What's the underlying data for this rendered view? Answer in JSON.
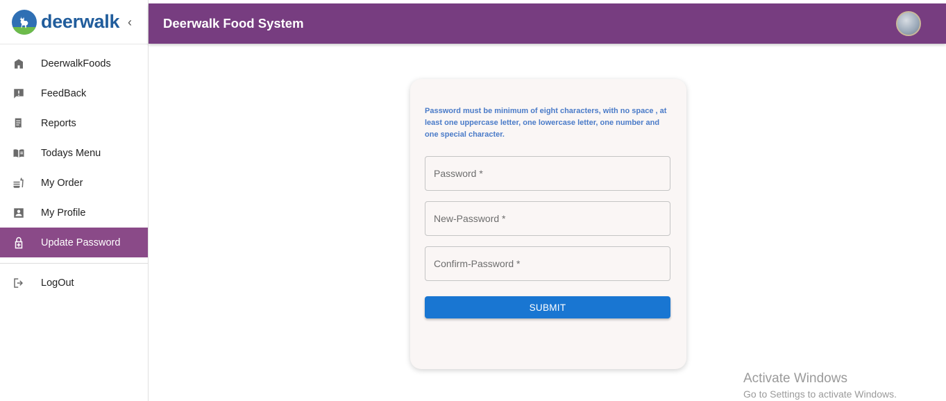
{
  "brand": {
    "name": "deerwalk",
    "logo_icon": "deer-logo-icon",
    "collapse_icon": "chevron-left-icon"
  },
  "sidebar": {
    "items": [
      {
        "label": "DeerwalkFoods",
        "icon": "home-icon"
      },
      {
        "label": "FeedBack",
        "icon": "feedback-icon"
      },
      {
        "label": "Reports",
        "icon": "receipt-icon"
      },
      {
        "label": "Todays Menu",
        "icon": "menu-book-icon"
      },
      {
        "label": "My Order",
        "icon": "order-icon"
      },
      {
        "label": "My Profile",
        "icon": "profile-icon"
      },
      {
        "label": "Update Password",
        "icon": "lock-plus-icon",
        "active": true
      }
    ],
    "logout": {
      "label": "LogOut",
      "icon": "logout-icon"
    }
  },
  "header": {
    "title": "Deerwalk Food System"
  },
  "form": {
    "rules": "Password must be minimum of eight characters, with no space , at least one uppercase letter, one lowercase letter, one number and one special character.",
    "password_placeholder": "Password *",
    "new_password_placeholder": "New-Password *",
    "confirm_password_placeholder": "Confirm-Password *",
    "submit_label": "SUBMIT"
  },
  "watermark": {
    "title": "Activate Windows",
    "subtitle": "Go to Settings to activate Windows."
  },
  "colors": {
    "header": "#773d80",
    "active_nav": "#8a4a88",
    "submit": "#1976d2",
    "rules_text": "#4a7bc8"
  }
}
